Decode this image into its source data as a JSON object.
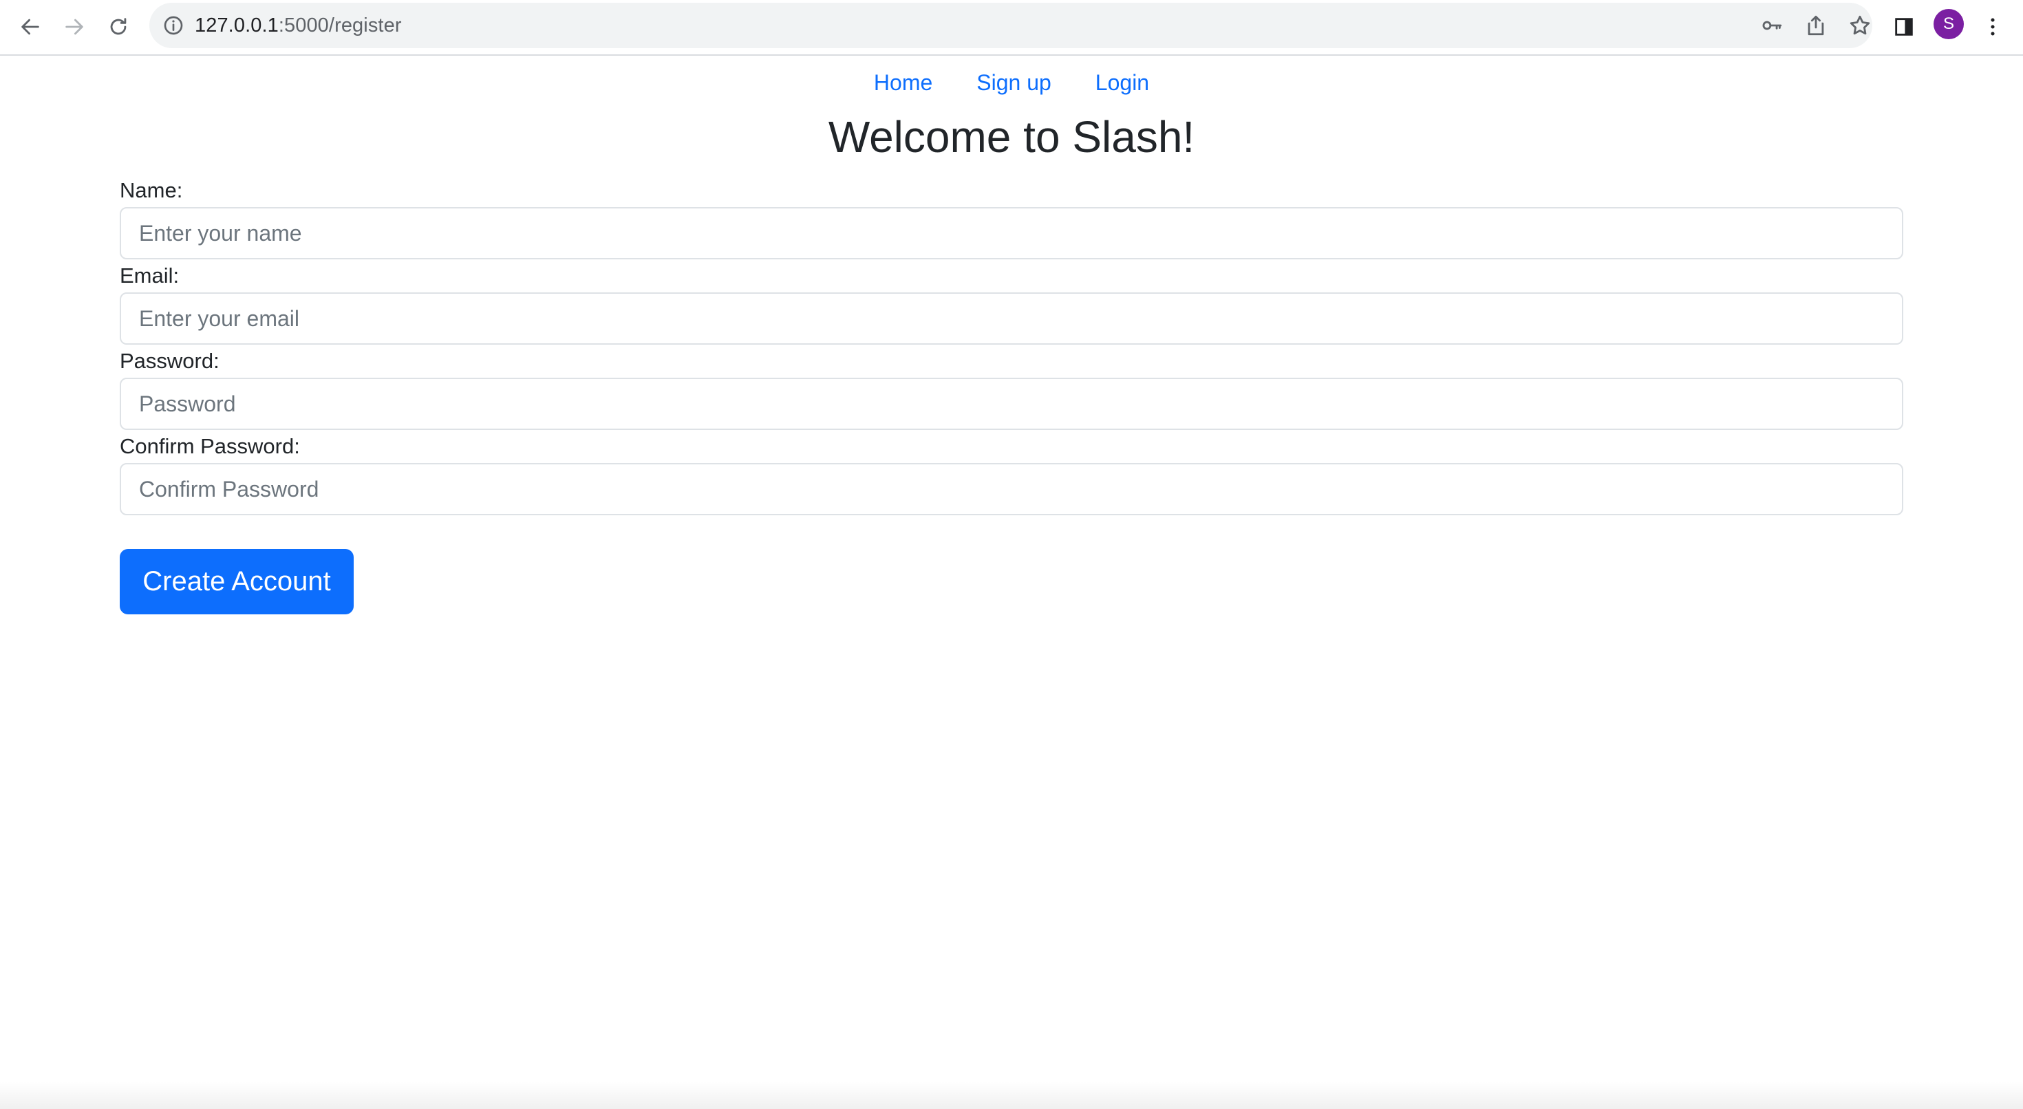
{
  "browser": {
    "url_host": "127.0.0.1",
    "url_rest": ":5000/register",
    "profile_initial": "S",
    "icons": {
      "back": "back-arrow-icon",
      "forward": "forward-arrow-icon",
      "reload": "reload-icon",
      "site_info": "info-icon",
      "password": "key-icon",
      "share": "share-icon",
      "bookmark": "star-icon",
      "side_panel": "side-panel-icon",
      "menu": "kebab-menu-icon"
    },
    "profile_color": "#7b1fa2"
  },
  "nav": {
    "items": [
      {
        "label": "Home"
      },
      {
        "label": "Sign up"
      },
      {
        "label": "Login"
      }
    ],
    "link_color": "#0d6efd"
  },
  "page": {
    "title": "Welcome to Slash!"
  },
  "form": {
    "fields": [
      {
        "label": "Name:",
        "placeholder": "Enter your name",
        "value": ""
      },
      {
        "label": "Email:",
        "placeholder": "Enter your email",
        "value": ""
      },
      {
        "label": "Password:",
        "placeholder": "Password",
        "value": ""
      },
      {
        "label": "Confirm Password:",
        "placeholder": "Confirm Password",
        "value": ""
      }
    ],
    "submit_label": "Create Account",
    "submit_color": "#0d6efd"
  }
}
